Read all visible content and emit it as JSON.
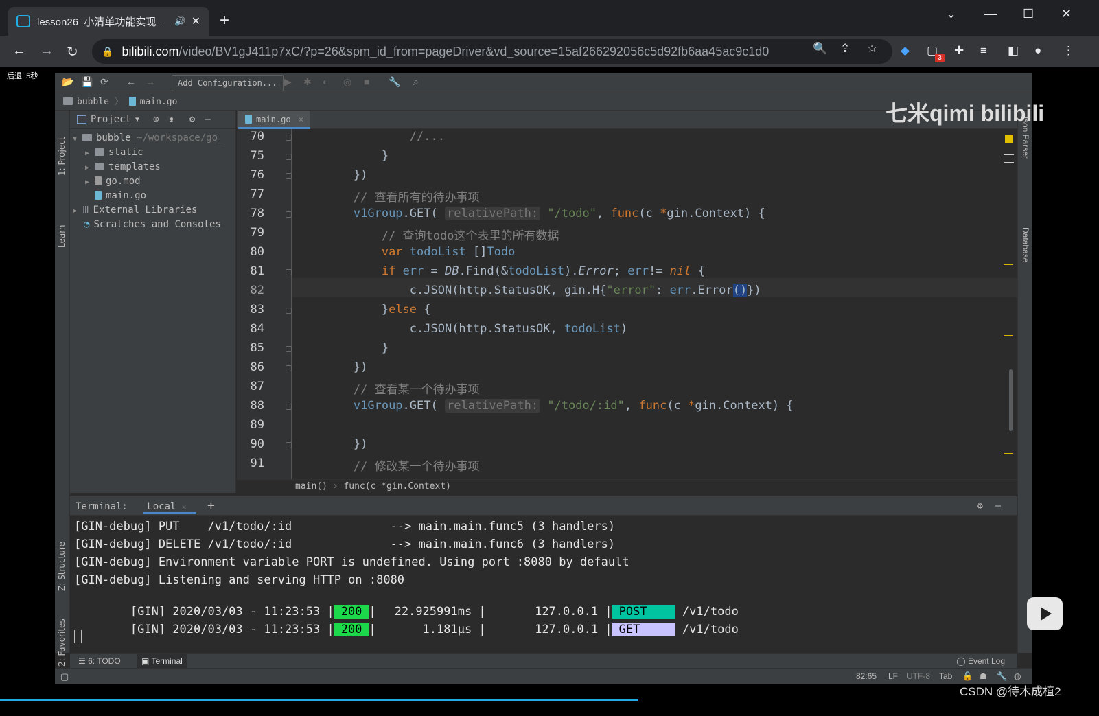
{
  "browser": {
    "tab_title": "lesson26_小清单功能实现_",
    "url_host": "bilibili.com",
    "url_path": "/video/BV1gJ411p7xC/?p=26&spm_id_from=pageDriver&vd_source=15af266292056c5d92fb6aa45ac9c1d0",
    "extension_badge": "3"
  },
  "video": {
    "overlay_text": "后退: 5秒",
    "watermark": "七米qimi bilibili",
    "footer_credit": "CSDN @待木成植2"
  },
  "ide": {
    "add_config_label": "Add Configuration...",
    "breadcrumb": [
      "bubble",
      "main.go"
    ],
    "left_tools": [
      "1: Project",
      "Learn",
      "Z: Structure",
      "2: Favorites"
    ],
    "right_tools": [
      "Json Parser",
      "Database"
    ],
    "project": {
      "header": "Project",
      "root_name": "bubble",
      "root_path": "~/workspace/go_",
      "items": [
        "static",
        "templates",
        "go.mod",
        "main.go"
      ],
      "external": "External Libraries",
      "scratches": "Scratches and Consoles"
    },
    "editor_tab": "main.go",
    "code_lines": [
      {
        "n": "70",
        "html": "        <span class=\"cm\">//...</span>"
      },
      {
        "n": "75",
        "html": "    }"
      },
      {
        "n": "76",
        "html": "})"
      },
      {
        "n": "77",
        "html": "<span class=\"cm\">// 查看所有的待办事项</span>"
      },
      {
        "n": "78",
        "html": "<span class=\"typ\">v1Group</span>.<span class=\"pkg\">GET</span>( <span class=\"hint\">relativePath:</span> <span class=\"str\">\"/todo\"</span>, <span class=\"kw\">func</span>(c <span class=\"kw\">*</span>gin.<span class=\"pkg\">Context</span>) {"
      },
      {
        "n": "79",
        "html": "    <span class=\"cm\">// 查询todo这个表里的所有数据</span>"
      },
      {
        "n": "80",
        "html": "    <span class=\"kw\">var</span> <span class=\"typ\">todoList</span> []<span class=\"typ\">Todo</span>"
      },
      {
        "n": "81",
        "html": "    <span class=\"kw\">if</span> <span class=\"typ\">err</span> = <span class=\"it\">DB</span>.<span class=\"pkg\">Find</span>(&amp;<span class=\"typ\">todoList</span>).<span class=\"it\">Error</span>; <span class=\"typ\">err</span>!= <span class=\"kw it\">nil</span> {"
      },
      {
        "n": "82",
        "html": "        c.<span class=\"pkg\">JSON</span>(http.<span class=\"pkg\">StatusOK</span>, gin.<span class=\"pkg\">H</span>{<span class=\"str\">\"error\"</span>: <span class=\"typ\">err</span>.<span class=\"pkg\">Error</span><span class=\"caret\">()</span>})"
      },
      {
        "n": "83",
        "html": "    }<span class=\"kw\">else</span> {"
      },
      {
        "n": "84",
        "html": "        c.<span class=\"pkg\">JSON</span>(http.<span class=\"pkg\">StatusOK</span>, <span class=\"typ\">todoList</span>)"
      },
      {
        "n": "85",
        "html": "    }"
      },
      {
        "n": "86",
        "html": "})"
      },
      {
        "n": "87",
        "html": "<span class=\"cm\">// 查看某一个待办事项</span>"
      },
      {
        "n": "88",
        "html": "<span class=\"typ\">v1Group</span>.<span class=\"pkg\">GET</span>( <span class=\"hint\">relativePath:</span> <span class=\"str\">\"/todo/:id\"</span>, <span class=\"kw\">func</span>(c <span class=\"kw\">*</span>gin.<span class=\"pkg\">Context</span>) {"
      },
      {
        "n": "89",
        "html": ""
      },
      {
        "n": "90",
        "html": "})"
      },
      {
        "n": "91",
        "html": "<span class=\"cm\">// 修改某一个待办事项</span>"
      }
    ],
    "code_crumb": "main() › func(c *gin.Context)",
    "terminal": {
      "label": "Terminal:",
      "tab": "Local",
      "lines": [
        "[GIN-debug] PUT    /v1/todo/:id              --> main.main.func5 (3 handlers)",
        "[GIN-debug] DELETE /v1/todo/:id              --> main.main.func6 (3 handlers)",
        "[GIN-debug] Environment variable PORT is undefined. Using port :8080 by default",
        "[GIN-debug] Listening and serving HTTP on :8080"
      ],
      "requests": [
        {
          "prefix": "[GIN] 2020/03/03 - 11:23:53 |",
          "status": "200",
          "latency": "22.925991ms |",
          "ip": "127.0.0.1 |",
          "method": "POST",
          "path": "/v1/todo"
        },
        {
          "prefix": "[GIN] 2020/03/03 - 11:23:53 |",
          "status": "200",
          "latency": "1.181µs |",
          "ip": "127.0.0.1 |",
          "method": "GET",
          "path": "/v1/todo"
        }
      ]
    },
    "bottom_tabs": {
      "todo": "6: TODO",
      "terminal": "Terminal",
      "event_log": "Event Log"
    },
    "status": {
      "position": "82:65",
      "line_sep": "LF",
      "encoding": "UTF-8",
      "indent": "Tab"
    }
  },
  "colors": {
    "accent": "#23ade5",
    "status_ok": "#1dd84a",
    "post": "#00c4a0",
    "get": "#c8c2ff"
  }
}
